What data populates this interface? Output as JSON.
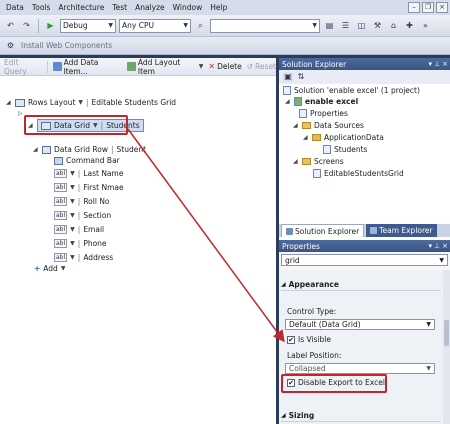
{
  "menubar": {
    "items": [
      "Data",
      "Tools",
      "Architecture",
      "Test",
      "Analyze",
      "Window",
      "Help"
    ]
  },
  "toolbar": {
    "config": "Debug",
    "platform": "Any CPU"
  },
  "toolbar2": {
    "install": "Install Web Components"
  },
  "designer": {
    "edit_query": "Edit Query",
    "add_data_item": "Add Data Item...",
    "add_layout_item": "Add Layout Item",
    "delete": "Delete",
    "reset": "Reset"
  },
  "tree": {
    "rows_layout": "Rows Layout",
    "grid_title": "Editable Students Grid",
    "data_grid": "Data Grid",
    "students": "Students",
    "data_grid_row": "Data Grid Row",
    "student": "Student",
    "command_bar": "Command Bar",
    "fields": [
      "Last Name",
      "First Nmae",
      "Roll No",
      "Section",
      "Email",
      "Phone",
      "Address"
    ],
    "abl": "abl",
    "add": "Add"
  },
  "solution_explorer": {
    "title": "Solution Explorer",
    "solution": "Solution 'enable excel' (1 project)",
    "project": "enable excel",
    "properties": "Properties",
    "data_sources": "Data Sources",
    "application_data": "ApplicationData",
    "students": "Students",
    "screens": "Screens",
    "screen_file": "EditableStudentsGrid",
    "tab_active": "Solution Explorer",
    "tab_inactive": "Team Explorer"
  },
  "properties": {
    "title": "Properties",
    "selected": "grid",
    "appearance": "Appearance",
    "control_type_label": "Control Type:",
    "control_type_value": "Default (Data Grid)",
    "is_visible": "Is Visible",
    "label_position": "Label Position:",
    "label_position_value": "Collapsed",
    "disable_export": "Disable Export to Excel",
    "sizing": "Sizing"
  },
  "colors": {
    "highlight": "#c0272d",
    "title_bar": "#3a5584"
  }
}
